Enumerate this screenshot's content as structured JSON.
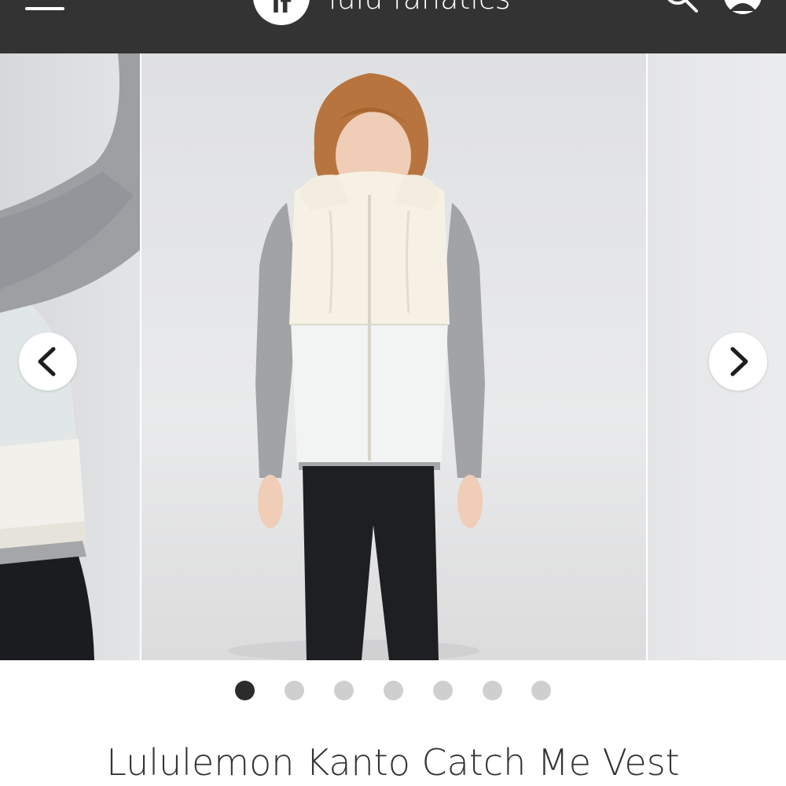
{
  "header": {
    "brand": "lulu fanatics",
    "logo_text": "lf",
    "background": "#333333",
    "icons": [
      "menu-icon",
      "search-icon",
      "profile-icon"
    ]
  },
  "carousel": {
    "prev_icon": "chevron-left-icon",
    "next_icon": "chevron-right-icon",
    "slide_count": 7,
    "active_index": 0
  },
  "product": {
    "title": "Lululemon Kanto Catch Me Vest"
  }
}
